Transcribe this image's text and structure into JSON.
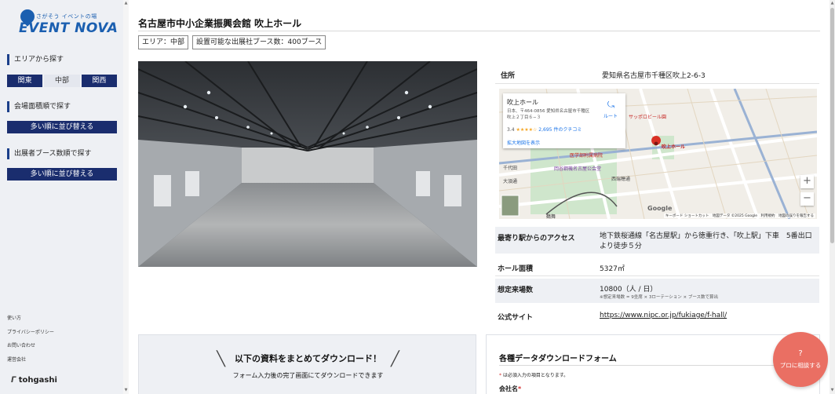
{
  "sidebar": {
    "logo_sub": "さがそう イベントの場",
    "logo_brand": "EVENT NOVA",
    "area_title": "エリアから探す",
    "regions": [
      "関東",
      "中部",
      "関西"
    ],
    "area_size_title": "会場面積順で探す",
    "area_size_sort": "多い順に並び替える",
    "booth_title": "出展者ブース数順で探す",
    "booth_sort": "多い順に並び替える",
    "footer_links": [
      "使い方",
      "プライバシーポリシー",
      "お問い合わせ",
      "運営会社"
    ],
    "company": "tohgashi"
  },
  "venue": {
    "title": "名古屋市中小企業振興会館 吹上ホール",
    "tags": [
      "エリア：中部",
      "設置可能な出展社ブース数：400ブース"
    ],
    "address_label": "住所",
    "address": "愛知県名古屋市千種区吹上2-6-3",
    "access_label": "最寄り駅からのアクセス",
    "access": "地下鉄桜通線「名古屋駅」から徳重行き、「吹上駅」下車　5番出口より徒歩５分",
    "hall_area_label": "ホール面積",
    "hall_area": "5327㎡",
    "visitors_label": "想定来場数",
    "visitors": "10800（人 / 日）",
    "visitors_note": "※想定来場数 = 9坐席 × 3ローテーション × ブース数で算出",
    "site_label": "公式サイト",
    "site_url": "https://www.nipc.or.jp/fukiage/f-hall/"
  },
  "map": {
    "place_name": "吹上ホール",
    "place_address": "日本、〒464-0856 愛知県名古屋市千種区吹上２丁目６−３",
    "rating": "3.4",
    "stars": "★★★★☆",
    "reviews": "2,695 件のクチコミ",
    "route": "ルート",
    "enlarge": "拡大地図を表示",
    "pin_label": "吹上ホール",
    "zoom_in": "+",
    "zoom_out": "−",
    "google": "Google",
    "footer": "キーボード ショートカット　地図データ ©2025 Google　利用規約　地図の誤りを報告する",
    "labels": [
      "今池",
      "千代田",
      "西瑞穂",
      "新栄",
      "医学部附属病院",
      "岡谷鋼機名古屋公会堂",
      "鶴舞",
      "大須通",
      "西瑞穂通",
      "セントラル吹上",
      "サッポロビール園"
    ]
  },
  "download": {
    "heading": "以下の資料をまとめてダウンロード！",
    "sub": "フォーム入力後の完了画面にてダウンロードできます"
  },
  "form": {
    "title": "各種データダウンロードフォーム",
    "note": "は必須入力の項目となります。",
    "company_label": "会社名"
  },
  "consult": {
    "icon": "?",
    "label": "プロに相談する"
  }
}
